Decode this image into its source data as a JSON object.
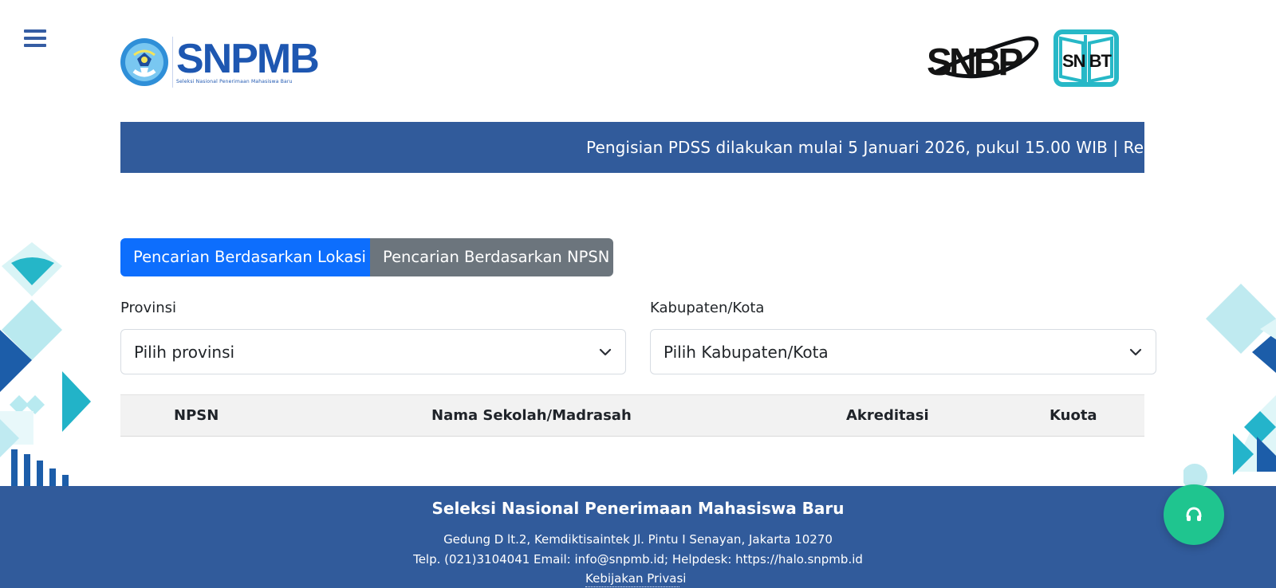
{
  "header": {
    "menu_icon": "hamburger-icon",
    "logo_left_main": "SNPMB",
    "logo_left_subtitle": "Seleksi Nasional Penerimaan Mahasiswa Baru",
    "logo_right_left": "SNBP",
    "logo_right_right": "SN BT",
    "brand_blue": "#1e57b1",
    "brand_teal": "#27b8c7"
  },
  "ticker": {
    "text": "Pengisian PDSS dilakukan mulai 5 Januari 2026, pukul 15.00 WIB | Registras",
    "background_color": "#315b9b"
  },
  "search_tabs": [
    {
      "label": "Pencarian Berdasarkan Lokasi",
      "active": true,
      "color": "#0d6efd"
    },
    {
      "label": "Pencarian Berdasarkan NPSN",
      "active": false,
      "color": "#6c757d"
    }
  ],
  "filters": {
    "provinsi": {
      "label": "Provinsi",
      "selected": "Pilih provinsi"
    },
    "kabupaten_kota": {
      "label": "Kabupaten/Kota",
      "selected": "Pilih Kabupaten/Kota"
    }
  },
  "table": {
    "columns": [
      "NPSN",
      "Nama Sekolah/Madrasah",
      "Akreditasi",
      "Kuota"
    ],
    "rows": []
  },
  "footer": {
    "title": "Seleksi Nasional Penerimaan Mahasiswa Baru",
    "address": "Gedung D lt.2, Kemdiktisaintek Jl. Pintu I Senayan, Jakarta 10270",
    "contact": "Telp. (021)3104041 Email: info@snpmb.id; Helpdesk: https://halo.snpmb.id",
    "privacy_link": "Kebijakan Privasi",
    "background_color": "#315b9b"
  },
  "help_button": {
    "icon": "headphones-icon",
    "color": "#1fc58f"
  }
}
